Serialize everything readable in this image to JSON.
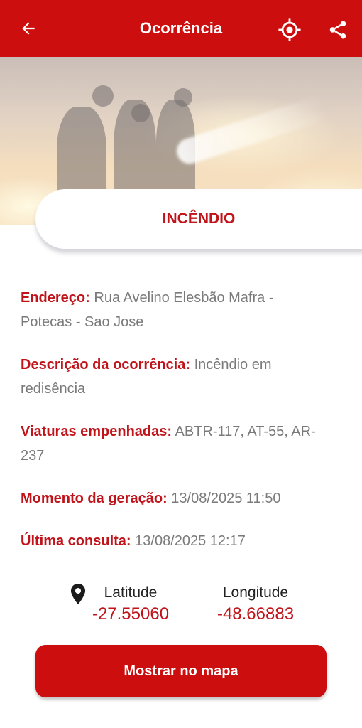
{
  "app_bar": {
    "title": "Ocorrência",
    "back_icon": "arrow-left-icon",
    "locate_icon": "crosshair-icon",
    "share_icon": "share-icon",
    "background": "#cc0e0e"
  },
  "occurrence": {
    "type": "INCÊNDIO",
    "fields": [
      {
        "label": "Endereço:",
        "value": "Rua Avelino Elesbão Mafra - Potecas - Sao Jose"
      },
      {
        "label": "Descrição da ocorrência:",
        "value": "Incêndio em redisência"
      },
      {
        "label": "Viaturas empenhadas:",
        "value": "ABTR-117, AT-55, AR-237"
      },
      {
        "label": "Momento da geração:",
        "value": "13/08/2025 11:50"
      },
      {
        "label": "Última consulta:",
        "value": "13/08/2025 12:17"
      }
    ]
  },
  "coordinates": {
    "pin_icon": "map-pin-icon",
    "latitude_label": "Latitude",
    "latitude_value": "-27.55060",
    "longitude_label": "Longitude",
    "longitude_value": "-48.66883"
  },
  "actions": {
    "show_on_map": "Mostrar no mapa"
  },
  "colors": {
    "accent": "#c0131a",
    "value_text": "#7a7a7a"
  }
}
